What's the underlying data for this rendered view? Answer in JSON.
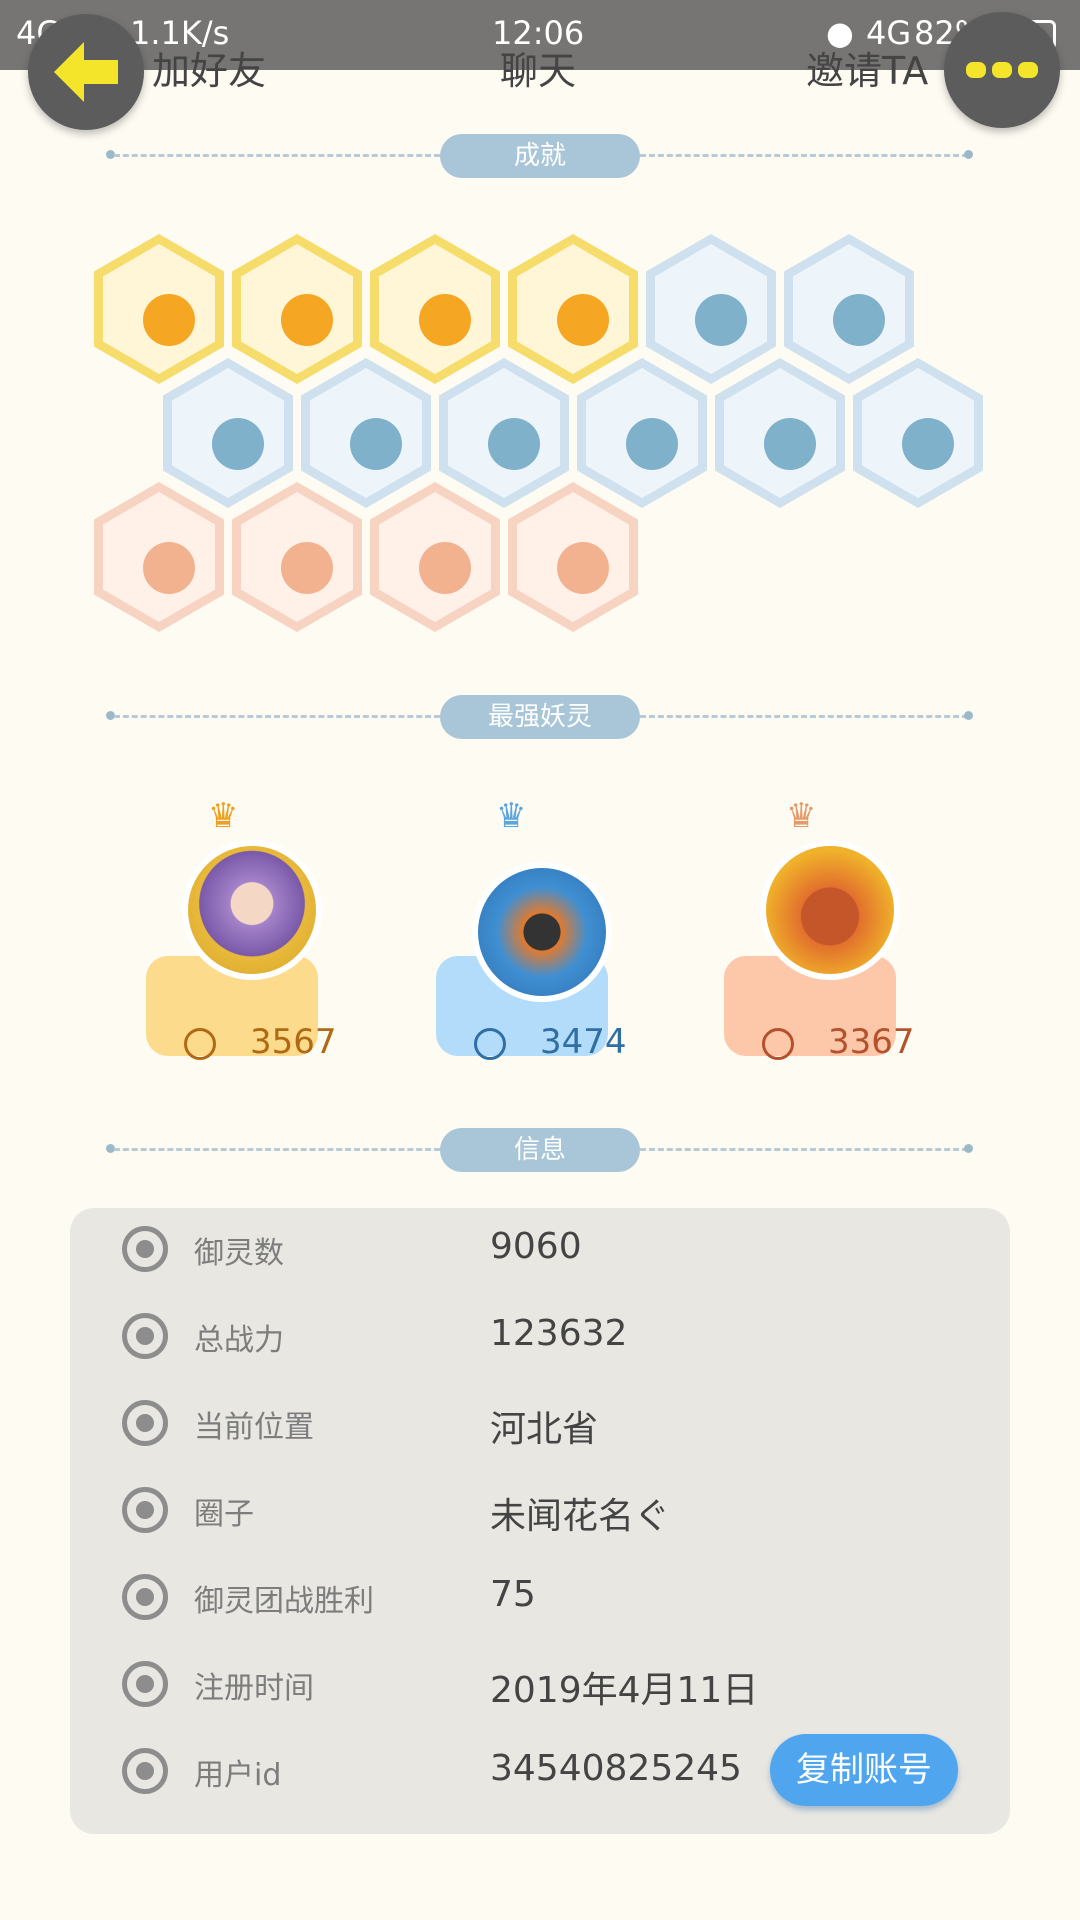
{
  "status_bar": {
    "network": "4G",
    "speed": "1.1K/s",
    "time": "12:06",
    "network_right": "4G",
    "battery": "82%"
  },
  "top_actions": {
    "add_friend": "加好友",
    "chat": "聊天",
    "invite": "邀请TA"
  },
  "sections": {
    "achievements": "成就",
    "strongest": "最强妖灵",
    "info": "信息"
  },
  "achievements": [
    {
      "name": "badge-01",
      "tier": "gold"
    },
    {
      "name": "badge-02",
      "tier": "gold"
    },
    {
      "name": "badge-03",
      "tier": "gold"
    },
    {
      "name": "badge-04",
      "tier": "gold"
    },
    {
      "name": "badge-05",
      "tier": "blue"
    },
    {
      "name": "badge-06",
      "tier": "blue"
    },
    {
      "name": "badge-07",
      "tier": "blue"
    },
    {
      "name": "badge-08",
      "tier": "blue"
    },
    {
      "name": "badge-09",
      "tier": "blue"
    },
    {
      "name": "badge-10",
      "tier": "blue"
    },
    {
      "name": "badge-11",
      "tier": "blue"
    },
    {
      "name": "badge-12",
      "tier": "blue"
    },
    {
      "name": "badge-13",
      "tier": "peach"
    },
    {
      "name": "badge-14",
      "tier": "peach"
    },
    {
      "name": "badge-15",
      "tier": "peach"
    },
    {
      "name": "badge-16",
      "tier": "peach"
    }
  ],
  "top_spirits": [
    {
      "rank": 1,
      "power": "3567",
      "color": "#fddb8c",
      "text_color": "#b06a14"
    },
    {
      "rank": 2,
      "power": "3474",
      "color": "#b3dcfb",
      "text_color": "#2f6fa3"
    },
    {
      "rank": 3,
      "power": "3367",
      "color": "#fdc7a9",
      "text_color": "#b4532b"
    }
  ],
  "info": {
    "rows": [
      {
        "label": "御灵数",
        "value": "9060",
        "icon": "spirit-icon"
      },
      {
        "label": "总战力",
        "value": "123632",
        "icon": "sword-icon"
      },
      {
        "label": "当前位置",
        "value": "河北省",
        "icon": "location-pin-icon"
      },
      {
        "label": "圈子",
        "value": "未闻花名ぐ",
        "icon": "circle-group-icon"
      },
      {
        "label": "御灵团战胜利",
        "value": "75",
        "icon": "trophy-icon"
      },
      {
        "label": "注册时间",
        "value": "2019年4月11日",
        "icon": "clock-icon"
      },
      {
        "label": "用户id",
        "value": "34540825245",
        "icon": "id-card-icon"
      }
    ],
    "copy_button": "复制账号"
  },
  "colors": {
    "background": "#fdfbf2",
    "section_pill": "#a9c6d8",
    "panel": "#e8e7e2",
    "accent_yellow": "#f5e52a",
    "copy_button": "#4fa6ee"
  }
}
